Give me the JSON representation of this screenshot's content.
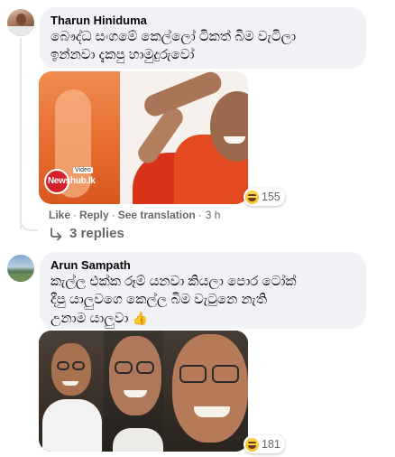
{
  "comments": [
    {
      "author": "Tharun Hiniduma",
      "text_line1": "බෞද්ධ සංගමේ කෙල්ලෝ ටිකත් බිම වැටිලා",
      "text_line2": "ඉන්නවා දැකපු හාමුදුරුවෝ",
      "reaction_count": "155",
      "photo_logo_text": "Newshub.lk",
      "photo_logo_tag": "Video",
      "actions": {
        "like": "Like",
        "reply": "Reply",
        "translate": "See translation",
        "timestamp": "3 h"
      },
      "replies_label": "3 replies"
    },
    {
      "author": "Arun Sampath",
      "text_line1": "කැල්ල එක්ක රූම් යනවා කියලා පොර ටෝක්",
      "text_line2": "දීපු යාලුවගෙ කෙල්ල බිම වැටුනෙ නැති",
      "text_line3": "උනාම යාලුවා",
      "text_emoji": "👍",
      "reaction_count": "181"
    }
  ],
  "icons": {
    "reaction": "haha-reaction-icon",
    "replies": "reply-arrow-icon"
  },
  "colors": {
    "bubble": "#f0f2f5",
    "meta": "#65676b",
    "text": "#050505"
  }
}
